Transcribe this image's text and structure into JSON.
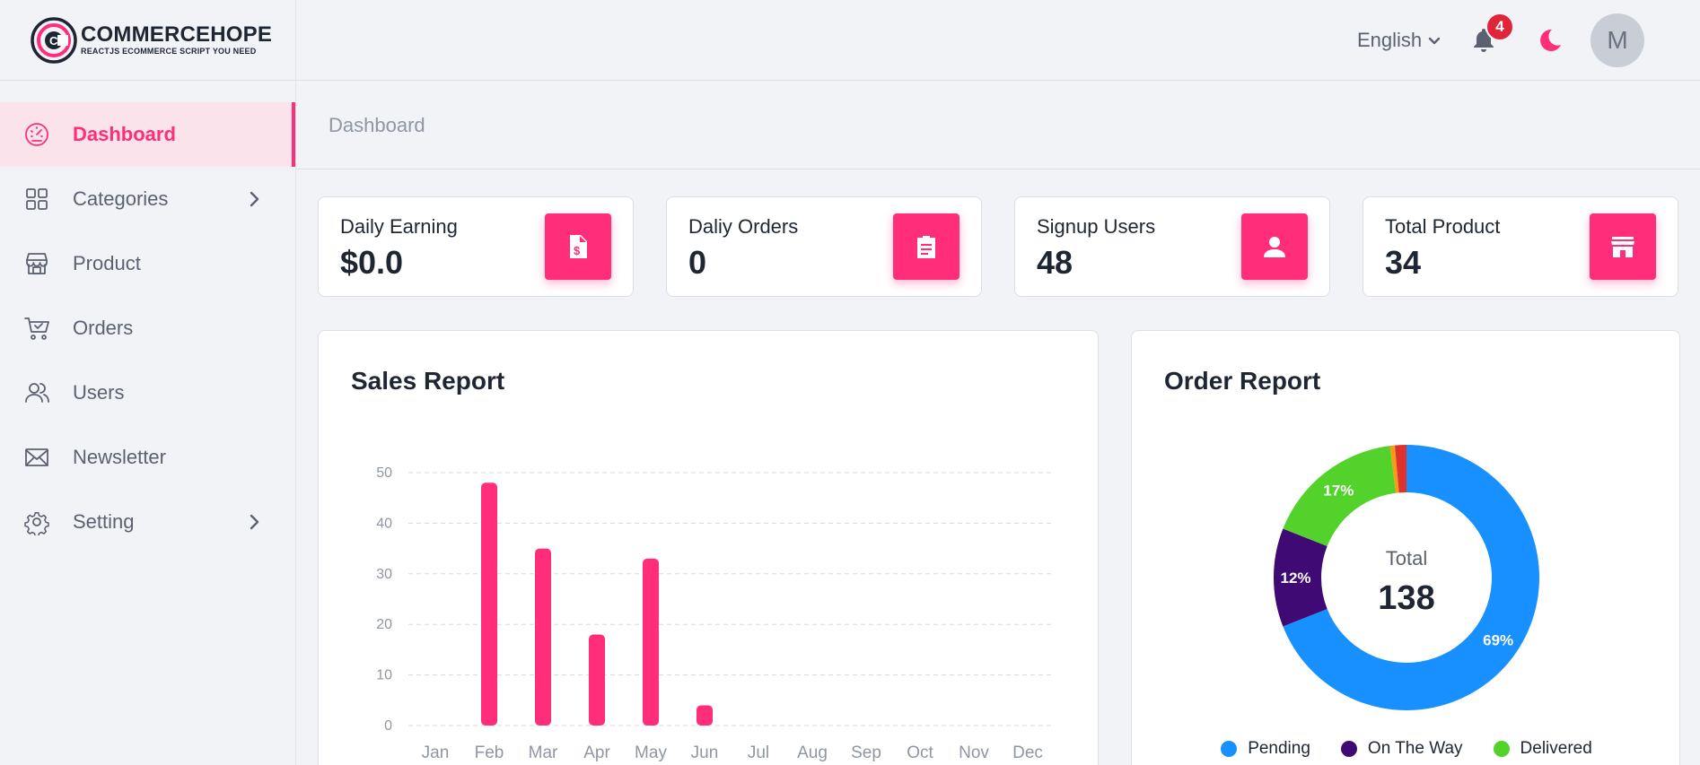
{
  "brand": {
    "name": "COMMERCEHOPE",
    "tagline": "REACTJS ECOMMERCE SCRIPT YOU NEED",
    "accent": "#ff2d7a"
  },
  "sidebar": {
    "items": [
      {
        "label": "Dashboard",
        "icon": "speedometer-icon",
        "active": true
      },
      {
        "label": "Categories",
        "icon": "grid-icon",
        "has_children": true
      },
      {
        "label": "Product",
        "icon": "store-icon"
      },
      {
        "label": "Orders",
        "icon": "cart-icon"
      },
      {
        "label": "Users",
        "icon": "users-icon"
      },
      {
        "label": "Newsletter",
        "icon": "mail-icon"
      },
      {
        "label": "Setting",
        "icon": "gear-icon",
        "has_children": true
      }
    ]
  },
  "header": {
    "language": "English",
    "notification_count": "4",
    "avatar_initial": "M"
  },
  "breadcrumb": "Dashboard",
  "stats": [
    {
      "label": "Daily Earning",
      "value": "$0.0",
      "icon": "invoice-dollar-icon"
    },
    {
      "label": "Daliy Orders",
      "value": "0",
      "icon": "clipboard-icon"
    },
    {
      "label": "Signup Users",
      "value": "48",
      "icon": "user-icon"
    },
    {
      "label": "Total Product",
      "value": "34",
      "icon": "shop-icon"
    }
  ],
  "sales_report": {
    "title": "Sales Report"
  },
  "order_report": {
    "title": "Order Report",
    "center_label": "Total",
    "center_value": "138"
  },
  "chart_data": [
    {
      "type": "bar",
      "title": "Sales Report",
      "categories": [
        "Jan",
        "Feb",
        "Mar",
        "Apr",
        "May",
        "Jun",
        "Jul",
        "Aug",
        "Sep",
        "Oct",
        "Nov",
        "Dec"
      ],
      "values": [
        0,
        48,
        35,
        18,
        33,
        4,
        0,
        0,
        0,
        0,
        0,
        0
      ],
      "ylim": [
        0,
        50
      ],
      "yticks": [
        0,
        10,
        20,
        30,
        40,
        50
      ],
      "grid": true,
      "color": "#ff2d7a"
    },
    {
      "type": "pie",
      "title": "Order Report",
      "slices": [
        {
          "name": "Pending",
          "value": 69,
          "label": "69%",
          "color": "#1890ff"
        },
        {
          "name": "On The Way",
          "value": 12,
          "label": "12%",
          "color": "#3f0a73"
        },
        {
          "name": "Delivered",
          "value": 17,
          "label": "17%",
          "color": "#52d22b"
        },
        {
          "name": "",
          "value": 0.6,
          "label": "",
          "color": "#f59d1b"
        },
        {
          "name": "",
          "value": 1.4,
          "label": "",
          "color": "#e0322d"
        }
      ],
      "legend": [
        "Pending",
        "On The Way",
        "Delivered"
      ],
      "legend_placement": "bottom"
    }
  ]
}
